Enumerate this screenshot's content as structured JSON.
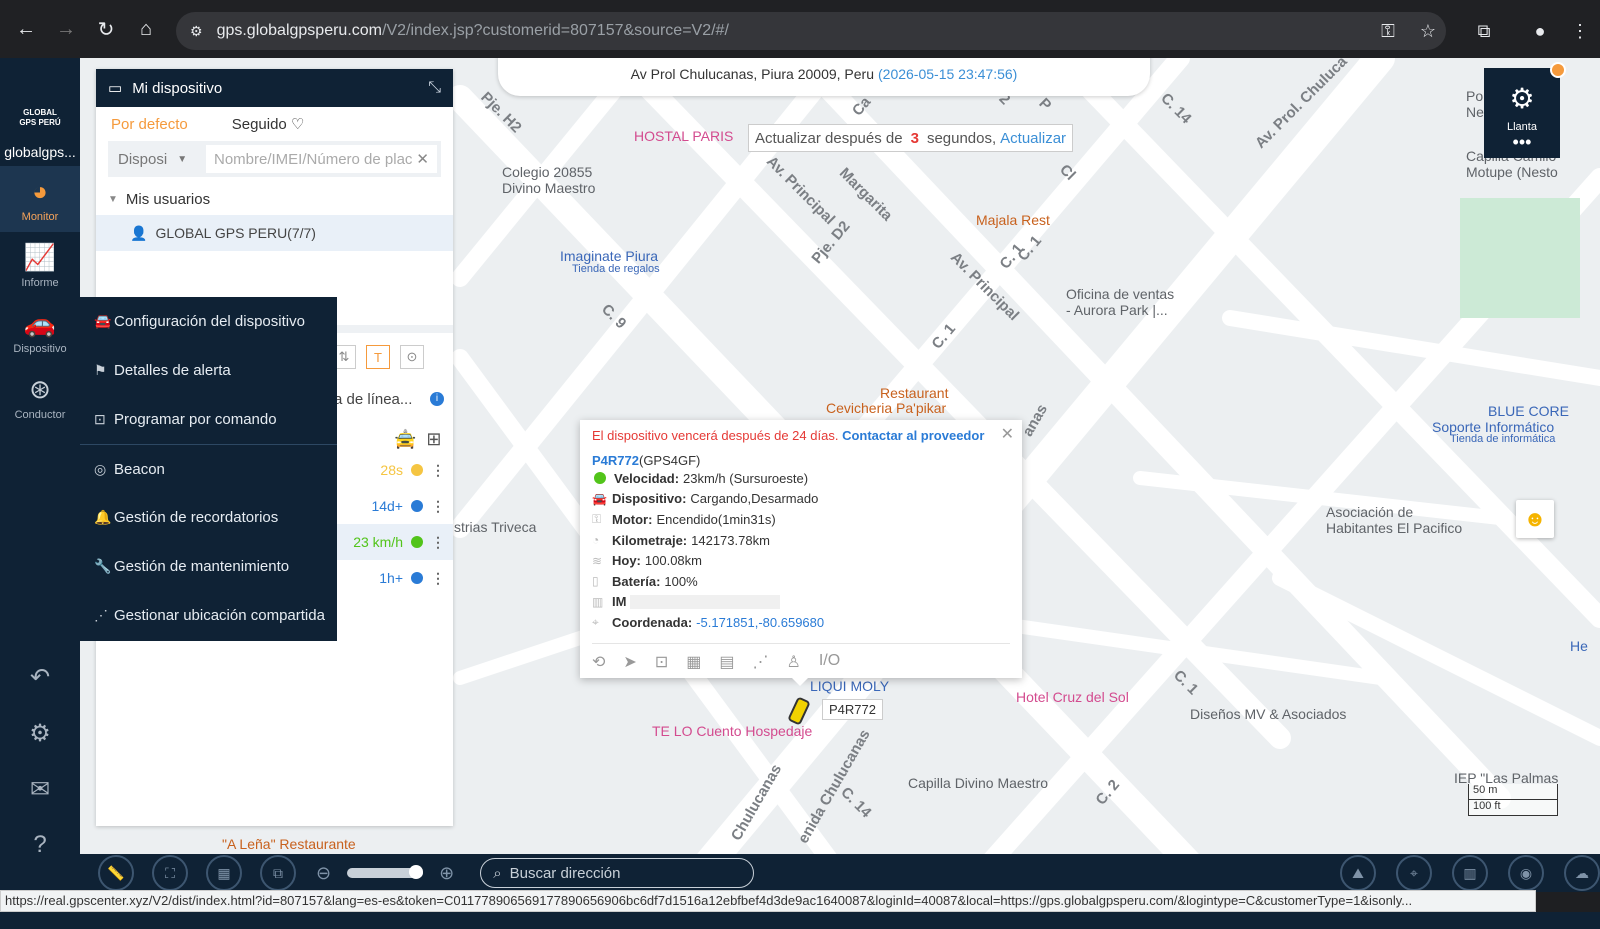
{
  "browser": {
    "url_host": "gps.globalgpsperu.com",
    "url_path": "/V2/index.jsp?customerid=807157&source=V2/#/"
  },
  "leftnav": {
    "logo_mark": "GLOBAL GPS PERÚ",
    "logo_text": "globalgps...",
    "items": [
      {
        "label": "Monitor",
        "icon": "monitor-icon"
      },
      {
        "label": "Informe",
        "icon": "chart-icon"
      },
      {
        "label": "Dispositivo",
        "icon": "car-icon"
      },
      {
        "label": "Conductor",
        "icon": "steering-wheel-icon"
      }
    ]
  },
  "map": {
    "address": "Av Prol Chulucanas, Piura 20009, Peru",
    "address_time": "(2026-05-15 23:47:56)",
    "refresh_prefix": "Actualizar después de",
    "refresh_count": "3",
    "refresh_suffix": "segundos,",
    "refresh_link": "Actualizar",
    "tire_label": "Llanta",
    "scale_m": "50 m",
    "scale_ft": "100 ft",
    "car_label": "P4R772",
    "pois": [
      {
        "text": "HOSTAL PARIS",
        "cls": "pink"
      },
      {
        "text": "Colegio 20855",
        "cls": "gray"
      },
      {
        "text": "Divino Maestro",
        "cls": "gray"
      },
      {
        "text": "Majala Rest",
        "cls": "orange"
      },
      {
        "text": "Imaginate Piura",
        "cls": "blue"
      },
      {
        "text": "Tienda de regalos",
        "cls": "blue"
      },
      {
        "text": "Oficina de ventas",
        "cls": "gray"
      },
      {
        "text": "- Aurora Park |...",
        "cls": "gray"
      },
      {
        "text": "Restaurant",
        "cls": "orange"
      },
      {
        "text": "Cevicheria Pa'pikar",
        "cls": "orange"
      },
      {
        "text": "BLUE CORE",
        "cls": "blue"
      },
      {
        "text": "Soporte Informático",
        "cls": "blue"
      },
      {
        "text": "Tienda de informática",
        "cls": "blue"
      },
      {
        "text": "Asociación de",
        "cls": "gray"
      },
      {
        "text": "Habitantes El Pacifico",
        "cls": "gray"
      },
      {
        "text": "strias Triveca",
        "cls": "gray"
      },
      {
        "text": "LIQUI MOLY",
        "cls": "blue"
      },
      {
        "text": "Hotel Cruz del Sol",
        "cls": "pink"
      },
      {
        "text": "Diseños MV & Asociados",
        "cls": "gray"
      },
      {
        "text": "TE LO Cuento Hospedaje",
        "cls": "pink"
      },
      {
        "text": "Capilla Divino Maestro",
        "cls": "gray"
      },
      {
        "text": "IEP \"Las Palmas",
        "cls": "gray"
      },
      {
        "text": "\"A Leña\" Restaurante",
        "cls": "orange"
      },
      {
        "text": "Motupe (Nesto",
        "cls": "gray"
      },
      {
        "text": "Capilla Camilo",
        "cls": "gray"
      },
      {
        "text": "Po",
        "cls": "gray"
      },
      {
        "text": "Ne",
        "cls": "gray"
      },
      {
        "text": "He",
        "cls": "blue"
      }
    ],
    "streets": [
      "Av. Prol. Chuluca",
      "Av. Principal",
      "Av. Principal",
      "Margarita",
      "Pje. D2",
      "Pje. H2",
      "C. 14",
      "C. 1",
      "C. 1",
      "C. 9",
      "C. 2",
      "C. 2",
      "C. 1",
      "C. 14",
      "Chulucanas",
      "enida Chulucanas",
      "Cl",
      "P",
      "Ca",
      "C. 1",
      "anas"
    ]
  },
  "popup": {
    "warning": "El dispositivo vencerá después de 24 días.",
    "warning_link": "Contactar al proveedor",
    "plate": "P4R772",
    "model": "(GPS4GF)",
    "rows": [
      {
        "key": "Velocidad:",
        "value": "23km/h (Sursuroeste)"
      },
      {
        "key": "Dispositivo:",
        "value": "Cargando,Desarmado"
      },
      {
        "key": "Motor:",
        "value": "Encendido(1min31s)"
      },
      {
        "key": "Kilometraje:",
        "value": "142173.78km"
      },
      {
        "key": "Hoy:",
        "value": "100.08km"
      },
      {
        "key": "Batería:",
        "value": "100%"
      },
      {
        "key": "IM",
        "value": ""
      },
      {
        "key": "Coordenada:",
        "value": "-5.171851,-80.659680"
      }
    ],
    "tools_io": "I/O"
  },
  "panel": {
    "title": "Mi dispositivo",
    "tab_default": "Por defecto",
    "tab_follow": "Seguido",
    "select_value": "Disposi",
    "search_placeholder": "Nombre/IMEI/Número de plac",
    "tree_root": "Mis usuarios",
    "tree_user": "GLOBAL GPS PERU(7/7)",
    "line_label": "a de línea...",
    "toolbar_t": "T",
    "devices": [
      {
        "status": "28s",
        "color": "#f5c542"
      },
      {
        "status": "14d+",
        "color": "#2a7bd6"
      },
      {
        "status": "23 km/h",
        "color": "#52c41a"
      },
      {
        "status": "1h+",
        "color": "#2a7bd6"
      }
    ]
  },
  "context_menu": {
    "items": [
      "Configuración del dispositivo",
      "Detalles de alerta",
      "Programar por comando",
      "Beacon",
      "Gestión de recordatorios",
      "Gestión de mantenimiento",
      "Gestionar ubicación compartida"
    ]
  },
  "bottombar": {
    "search_placeholder": "Buscar dirección"
  },
  "status_url": "https://real.gpscenter.xyz/V2/dist/index.html?id=807157&lang=es-es&token=C0117789065691778906569​06bc6df7d1516a12ebfbef4d3de9ac1640087&loginId=40087&local=https://gps.globalgpsperu.com/&logintype=C&customerType=1&isonly..."
}
